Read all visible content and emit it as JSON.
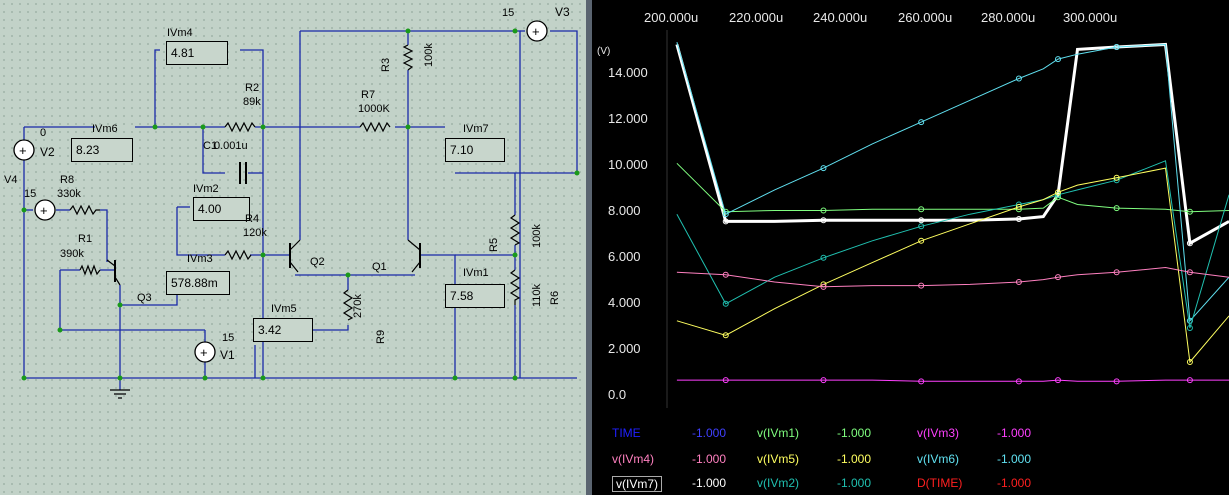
{
  "schematic": {
    "meters": [
      {
        "id": "IVm4",
        "value": "4.81"
      },
      {
        "id": "IVm6",
        "value": "8.23"
      },
      {
        "id": "IVm2",
        "value": "4.00"
      },
      {
        "id": "IVm3",
        "value": "578.88m"
      },
      {
        "id": "IVm5",
        "value": "3.42"
      },
      {
        "id": "IVm7",
        "value": "7.10"
      },
      {
        "id": "IVm1",
        "value": "7.58"
      }
    ],
    "components": {
      "V2": "V2",
      "V2_value": "0",
      "V4": "V4",
      "V4_value": "15",
      "V1": "V1",
      "V1_value": "15",
      "V3": "V3",
      "V3_value": "15",
      "R1": "R1",
      "R1_value": "390k",
      "R2": "R2",
      "R2_value": "89k",
      "R3": "R3",
      "R3_value": "100k",
      "R4": "R4",
      "R4_value": "120k",
      "R5": "R5",
      "R5_value": "100k",
      "R6": "R6",
      "R6_value": "110k",
      "R7": "R7",
      "R7_value": "1000K",
      "R8": "R8",
      "R8_value": "330k",
      "R9": "R9",
      "R9_value": "270k",
      "C1": "C1",
      "C1_value": "0.001u",
      "Q1": "Q1",
      "Q2": "Q2",
      "Q3": "Q3"
    }
  },
  "scope": {
    "y_unit": "(V)",
    "x_ticks": [
      "200.000u",
      "220.000u",
      "240.000u",
      "260.000u",
      "280.000u",
      "300.000u"
    ],
    "y_ticks": [
      "14.000",
      "12.000",
      "10.000",
      "8.000",
      "6.000",
      "4.000",
      "2.000",
      "0.0"
    ],
    "legend": [
      {
        "label": "TIME",
        "value": "-1.000",
        "color": "#2020ff"
      },
      {
        "label": "v(IVm1)",
        "value": "-1.000",
        "color": "#80ff80"
      },
      {
        "label": "v(IVm3)",
        "value": "-1.000",
        "color": "#ff40ff"
      },
      {
        "label": "v(IVm4)",
        "value": "-1.000",
        "color": "#ff80c0"
      },
      {
        "label": "v(IVm5)",
        "value": "-1.000",
        "color": "#ffff60"
      },
      {
        "label": "v(IVm6)",
        "value": "-1.000",
        "color": "#60e0f0"
      },
      {
        "label": "v(IVm7)",
        "value": "-1.000",
        "color": "#ffffff"
      },
      {
        "label": "v(IVm2)",
        "value": "-1.000",
        "color": "#20c0b0"
      },
      {
        "label": "D(TIME)",
        "value": "-1.000",
        "color": "#ff2020"
      }
    ]
  },
  "chart_data": {
    "type": "line",
    "xlabel": "",
    "ylabel": "(V)",
    "x_unit_ticks": [
      "200.000u",
      "220.000u",
      "240.000u",
      "260.000u",
      "280.000u",
      "300.000u"
    ],
    "xlim": [
      199,
      313
    ],
    "ylim": [
      -0.6,
      15
    ],
    "x": [
      200,
      210,
      220,
      230,
      240,
      250,
      260,
      270,
      275,
      278,
      282,
      290,
      300,
      305,
      313
    ],
    "series": [
      {
        "name": "v(IVm7)",
        "color": "#ffffff",
        "values": [
          14.4,
          7.1,
          7.1,
          7.15,
          7.15,
          7.15,
          7.15,
          7.2,
          7.3,
          8.2,
          14.2,
          14.3,
          14.4,
          6.2,
          7.1
        ]
      },
      {
        "name": "v(IVm1)",
        "color": "#80ff80",
        "values": [
          9.5,
          7.5,
          7.55,
          7.55,
          7.6,
          7.6,
          7.6,
          7.6,
          7.65,
          8.1,
          7.8,
          7.65,
          7.6,
          7.5,
          7.55
        ]
      },
      {
        "name": "v(IVm6)",
        "color": "#60e0f0",
        "values": [
          14.5,
          7.4,
          8.4,
          9.3,
          10.3,
          11.2,
          12.1,
          13.0,
          13.4,
          13.8,
          14.0,
          14.3,
          14.4,
          3.0,
          4.8
        ]
      },
      {
        "name": "v(IVm2)",
        "color": "#20c0b0",
        "values": [
          7.4,
          3.7,
          4.8,
          5.6,
          6.3,
          6.9,
          7.4,
          7.8,
          8.0,
          8.2,
          8.4,
          8.8,
          9.6,
          2.7,
          8.2
        ]
      },
      {
        "name": "v(IVm5)",
        "color": "#ffff60",
        "values": [
          3.0,
          2.4,
          3.5,
          4.5,
          5.4,
          6.3,
          7.0,
          7.7,
          8.0,
          8.3,
          8.6,
          8.9,
          9.3,
          1.3,
          3.2
        ]
      },
      {
        "name": "v(IVm4)",
        "color": "#ff80c0",
        "values": [
          5.0,
          4.9,
          4.6,
          4.4,
          4.45,
          4.45,
          4.5,
          4.6,
          4.7,
          4.8,
          4.9,
          5.0,
          5.2,
          5.0,
          4.8
        ]
      },
      {
        "name": "v(IVm3)",
        "color": "#ff40ff",
        "values": [
          0.55,
          0.55,
          0.55,
          0.55,
          0.55,
          0.5,
          0.5,
          0.5,
          0.5,
          0.55,
          0.5,
          0.5,
          0.55,
          0.55,
          0.55
        ]
      }
    ]
  }
}
